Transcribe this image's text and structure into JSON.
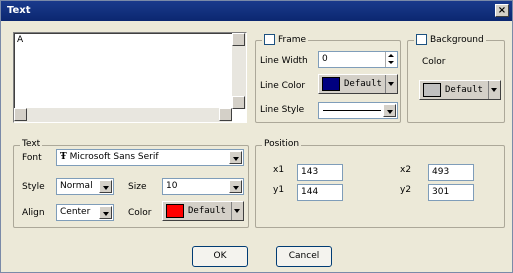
{
  "window": {
    "title": "Text",
    "close_glyph": "×"
  },
  "text_area": {
    "value": "A"
  },
  "frame": {
    "label": "Frame",
    "line_width_label": "Line Width",
    "line_width_value": "0",
    "line_color_label": "Line Color",
    "line_color_value": "Default",
    "line_color_hex": "#000080",
    "line_style_label": "Line Style"
  },
  "background": {
    "label": "Background",
    "color_label": "Color",
    "color_value": "Default",
    "color_hex": "#c0c0c0"
  },
  "text_group": {
    "label": "Text",
    "font_label": "Font",
    "font_value": "Microsoft Sans Serif",
    "style_label": "Style",
    "style_value": "Normal",
    "size_label": "Size",
    "size_value": "10",
    "align_label": "Align",
    "align_value": "Center",
    "color_label": "Color",
    "color_value": "Default",
    "color_hex": "#ff0000"
  },
  "position": {
    "label": "Position",
    "x1_label": "x1",
    "x1_value": "143",
    "y1_label": "y1",
    "y1_value": "144",
    "x2_label": "x2",
    "x2_value": "493",
    "y2_label": "y2",
    "y2_value": "301"
  },
  "buttons": {
    "ok": "OK",
    "cancel": "Cancel"
  }
}
